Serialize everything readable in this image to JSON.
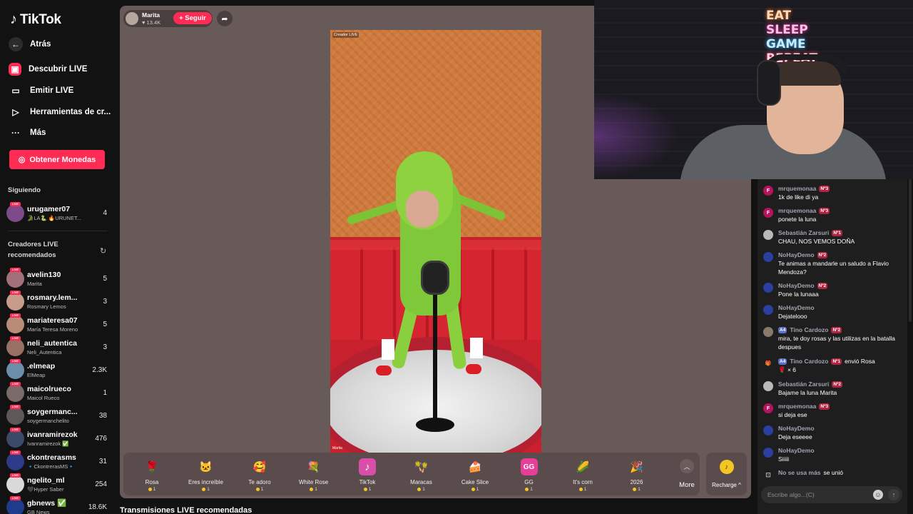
{
  "app": {
    "name": "TikTok"
  },
  "nav": {
    "back": "Atrás",
    "discover": "Descubrir LIVE",
    "go_live": "Emitir LIVE",
    "tools": "Herramientas de cr...",
    "more": "Más",
    "get_coins": "Obtener Monedas"
  },
  "following": {
    "label": "Siguiendo",
    "items": [
      {
        "name": "urugamer07",
        "sub": "🐊LA🐍 🔥URUNET...",
        "count": "4"
      }
    ]
  },
  "recommended": {
    "label_line1": "Creadores LIVE",
    "label_line2": "recomendados",
    "items": [
      {
        "name": "avelin130",
        "sub": "Marita",
        "count": "5",
        "color": "#a36f7a"
      },
      {
        "name": "rosmary.lem...",
        "sub": "Rosmary Lemos",
        "count": "3",
        "color": "#c79c8a"
      },
      {
        "name": "mariateresa07",
        "sub": "María Teresa Moreno",
        "count": "5",
        "color": "#b98c78"
      },
      {
        "name": "neli_autentica",
        "sub": "Neli_Autentica",
        "count": "3",
        "color": "#9a7064"
      },
      {
        "name": ".elmeap",
        "sub": "ElMeap",
        "count": "2.3K",
        "color": "#6b8fa8"
      },
      {
        "name": "maicolrueco",
        "sub": "Maicol Rueco",
        "count": "1",
        "color": "#7a6a6a"
      },
      {
        "name": "soygermanc...",
        "sub": "soygermanchelito",
        "count": "38",
        "color": "#5e5858"
      },
      {
        "name": "ivanramirezok",
        "sub": "Ivanramirezok ✅",
        "count": "476",
        "color": "#3c4a6a"
      },
      {
        "name": "ckontrerasms",
        "sub": "🔹CkontrerasMS🔹",
        "count": "31",
        "color": "#2e3a8a"
      },
      {
        "name": "ngelito_ml",
        "sub": "🖤Hyper Saber",
        "count": "254",
        "color": "#d9d9d9"
      },
      {
        "name": "gbnews ✅",
        "sub": "GB News",
        "count": "18.6K",
        "color": "#1d3d8c"
      }
    ]
  },
  "stream": {
    "host_name": "Marita",
    "host_likes": "♥ 13.4K",
    "follow": "+ Seguir",
    "tag_creator": "Creador LIVE",
    "tag_host": "Marita"
  },
  "gifts": [
    {
      "name": "Rosa",
      "price": "1",
      "icon": "🌹",
      "bg": "transparent"
    },
    {
      "name": "Eres increíble",
      "price": "1",
      "icon": "🐱",
      "bg": "transparent"
    },
    {
      "name": "Te adoro",
      "price": "1",
      "icon": "🥰",
      "bg": "transparent"
    },
    {
      "name": "White Rose",
      "price": "1",
      "icon": "💐",
      "bg": "transparent"
    },
    {
      "name": "TikTok",
      "price": "1",
      "icon": "♪",
      "bg": "#d84ea8"
    },
    {
      "name": "Maracas",
      "price": "1",
      "icon": "🪇",
      "bg": "transparent"
    },
    {
      "name": "Cake Slice",
      "price": "1",
      "icon": "🍰",
      "bg": "transparent"
    },
    {
      "name": "GG",
      "price": "1",
      "icon": "GG",
      "bg": "#e53f97"
    },
    {
      "name": "It's corn",
      "price": "1",
      "icon": "🌽",
      "bg": "transparent"
    },
    {
      "name": "2026",
      "price": "1",
      "icon": "🎉",
      "bg": "transparent"
    }
  ],
  "gift_more": "More",
  "recharge": "Recharge ^",
  "recommended_streams": "Transmisiones LIVE recomendadas",
  "webcam": {
    "neon_1": "EAT",
    "neon_2": "SLEEP",
    "neon_3": "GAME",
    "neon_4": "REPEAT"
  },
  "chat": {
    "messages": [
      {
        "user": "mrquemonaa",
        "badge": "Nº3",
        "text": "1k de like di ya",
        "avatar": "F",
        "avcolor": "#b6135f"
      },
      {
        "user": "mrquemonaa",
        "badge": "Nº3",
        "text": "ponete la luna",
        "avatar": "F",
        "avcolor": "#b6135f"
      },
      {
        "user": "Sebastián Zarsuri",
        "badge": "Nº1",
        "text": "CHAU, NOS VEMOS DOÑA",
        "avatar": "",
        "avcolor": "#b9b9b9"
      },
      {
        "user": "NoHayDemo",
        "badge": "Nº2",
        "text": "Te animas a mandarle un saludo a Flavio Mendoza?",
        "avatar": "",
        "avcolor": "#2a3fa0"
      },
      {
        "user": "NoHayDemo",
        "badge": "Nº2",
        "text": "Pone la lunaaa",
        "avatar": "",
        "avcolor": "#2a3fa0"
      },
      {
        "user": "NoHayDemo",
        "badge": "",
        "text": "Dejatelooo",
        "avatar": "",
        "avcolor": "#2a3fa0"
      },
      {
        "user": "Tino Cardozo",
        "level": "A4",
        "badge": "Nº2",
        "text": "mira, te doy rosas y las utilizas en la batalla despues",
        "avatar": "",
        "avcolor": "#8a7a6a"
      },
      {
        "user": "Tino Cardozo",
        "level": "A4",
        "badge": "Nº1",
        "suffix": "envió Rosa",
        "text": "🌹 × 6",
        "avatar": "🎁",
        "avcolor": "transparent"
      },
      {
        "user": "Sebastián Zarsuri",
        "badge": "Nº2",
        "text": "Bajame la luna Marita",
        "avatar": "",
        "avcolor": "#b9b9b9"
      },
      {
        "user": "mrquemonaa",
        "badge": "Nº3",
        "text": "si deja ese",
        "avatar": "F",
        "avcolor": "#b6135f"
      },
      {
        "user": "NoHayDemo",
        "badge": "",
        "text": "Deja eseeee",
        "avatar": "",
        "avcolor": "#2a3fa0"
      },
      {
        "user": "NoHayDemo",
        "badge": "",
        "text": "Siiiii",
        "avatar": "",
        "avcolor": "#2a3fa0"
      }
    ],
    "join_user": "No se usa más",
    "join_text": "se unió",
    "input_placeholder": "Escribe algo...(C)"
  }
}
